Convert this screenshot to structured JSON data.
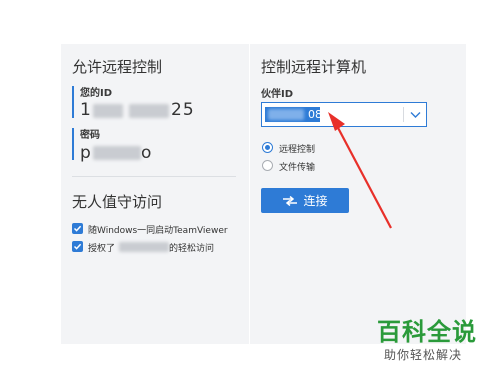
{
  "left": {
    "title": "允许远程控制",
    "your_id_label": "您的ID",
    "your_id_value_start": "1",
    "your_id_value_end": "25",
    "password_label": "密码",
    "password_value_start": "p",
    "password_value_end": "o",
    "unattended_title": "无人值守访问",
    "checkbox1_label": "随Windows一同启动TeamViewer",
    "checkbox1_checked": true,
    "checkbox2_label_start": "授权了",
    "checkbox2_label_end": "的轻松访问",
    "checkbox2_checked": true
  },
  "right": {
    "title": "控制远程计算机",
    "partner_id_label": "伙伴ID",
    "partner_id_value": "08",
    "options": [
      "远程控制",
      "文件传输"
    ],
    "selected_option": "远程控制",
    "connect_label": "连接"
  },
  "watermark": {
    "title": "百科全说",
    "subtitle": "助你轻松解决"
  },
  "colors": {
    "accent": "#2e7bd6",
    "arrow": "#e8302a",
    "watermark_green": "#2a9a3a"
  }
}
